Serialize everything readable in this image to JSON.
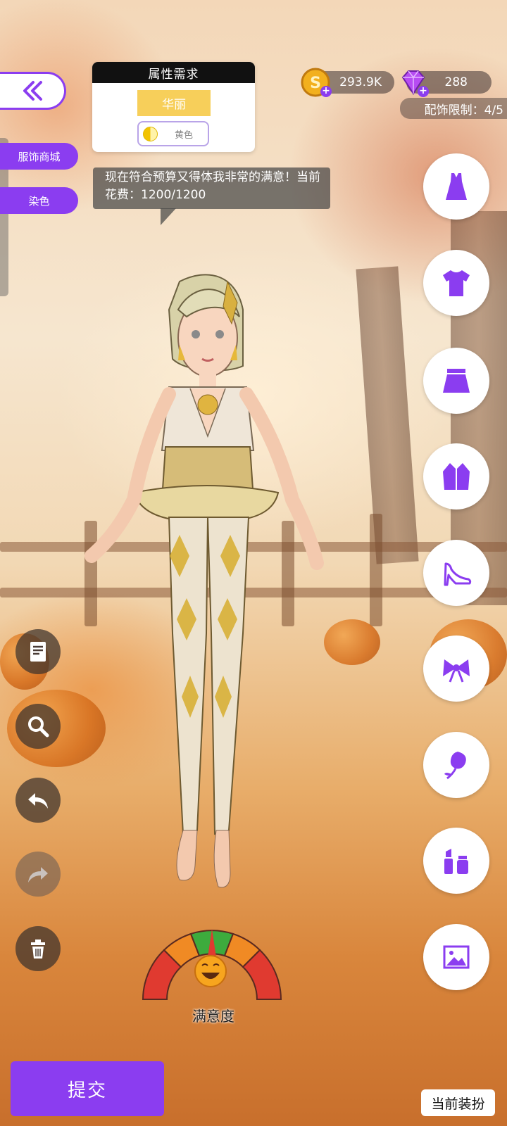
{
  "sidebar": {
    "shop_label": "服饰商城",
    "dye_label": "染色"
  },
  "requirement": {
    "title": "属性需求",
    "attribute": "华丽",
    "color_label": "黄色"
  },
  "speech": {
    "text": "现在符合预算又得体我非常的满意！当前花费：1200/1200"
  },
  "currency": {
    "coins": "293.9K",
    "gems": "288"
  },
  "accessory_limit": "配饰限制：4/5",
  "categories": [
    {
      "icon": "dress-icon"
    },
    {
      "icon": "tshirt-icon"
    },
    {
      "icon": "skirt-icon"
    },
    {
      "icon": "jacket-icon"
    },
    {
      "icon": "high-heel-icon"
    },
    {
      "icon": "bow-icon"
    },
    {
      "icon": "rose-icon"
    },
    {
      "icon": "makeup-icon"
    },
    {
      "icon": "background-image-icon"
    }
  ],
  "gauge": {
    "label": "满意度"
  },
  "actions": {
    "submit_label": "提交",
    "current_outfit_label": "当前装扮"
  },
  "colors": {
    "accent": "#8b3df0",
    "requirement_attr": "#f7cf5a",
    "gauge_green": "#3dab3d",
    "gauge_red": "#e03a30",
    "gauge_orange": "#f08a24"
  }
}
